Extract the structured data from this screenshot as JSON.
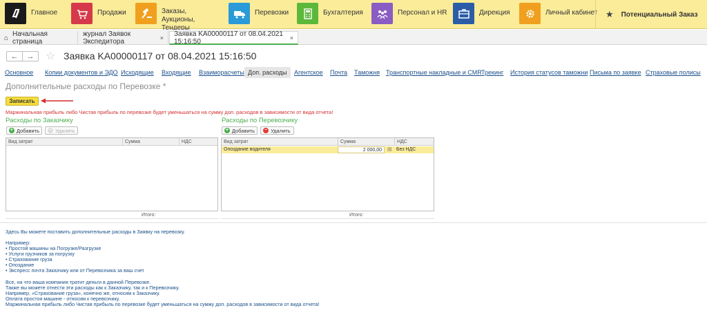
{
  "sections": [
    {
      "label": "Главное",
      "icon": "logo-icon",
      "color": "#1a1a1a"
    },
    {
      "label": "Продажи",
      "icon": "cart-icon",
      "color": "#d63a4a"
    },
    {
      "label": "Заказы, Аукционы, Тендеры",
      "icon": "gavel-icon",
      "color": "#f0a01e"
    },
    {
      "label": "Перевозки",
      "icon": "truck-icon",
      "color": "#2a9ad8"
    },
    {
      "label": "Бухгалтерия",
      "icon": "calculator-icon",
      "color": "#5cb83a"
    },
    {
      "label": "Персонал и HR",
      "icon": "people-icon",
      "color": "#8a5cc4"
    },
    {
      "label": "Дирекция",
      "icon": "briefcase-icon",
      "color": "#2a5ca8"
    },
    {
      "label": "Личный кабинет",
      "icon": "gear-icon",
      "color": "#f0a01e"
    }
  ],
  "favorite": {
    "label": "Потенциальный Заказ",
    "icon": "star-icon"
  },
  "window_tabs": [
    {
      "label": "Начальная страница",
      "icon": "home-icon"
    },
    {
      "label": "журнал Заявок Экспедитора",
      "close": "×"
    },
    {
      "label": "Заявка KA00000117 от 08.04.2021 15:16:50",
      "close": "×"
    }
  ],
  "nav": {
    "back": "←",
    "forward": "→",
    "favorite_icon": "☆"
  },
  "doc_title": "Заявка KA00000117 от 08.04.2021 15:16:50",
  "subtabs": [
    "Основное",
    "Копии документов и ЭДО",
    "Исходящие",
    "Входящие",
    "Взаиморасчеты",
    "Доп. расходы",
    "Агентское",
    "Почта",
    "Таможня",
    "Транспортные накладные и CMR",
    "Трекинг",
    "История статусов таможни",
    "Письма по заявке",
    "Страховые полисы"
  ],
  "active_subtab": "Доп. расходы",
  "form_title": "Дополнительные расходы по Перевозке *",
  "save_button": "Записать",
  "warning": "Маржинальная прибыль либо Чистая прибыль по перевозке будет уменьшаться на сумму доп. расходов в зависимости от вида отчета!",
  "customer_panel": {
    "title": "Расходы по Заказчику",
    "add": "Добавить",
    "remove": "Удалить",
    "columns": [
      "Вид затрат",
      "Сумма",
      "НДС"
    ],
    "rows": [],
    "total_label": "Итого:"
  },
  "carrier_panel": {
    "title": "Расходы по Перевозчику",
    "add": "Добавить",
    "remove": "Удалить",
    "columns": [
      "Вид затрат",
      "Сумма",
      "НДС"
    ],
    "rows": [
      {
        "type": "Опоздание водителя",
        "sum": "2 000,00",
        "vat": "Без НДС"
      }
    ],
    "total_label": "Итого:"
  },
  "help": {
    "intro": "Здесь Вы можете поставить дополнительные расходы в Заявку на перевозку.",
    "example_label": "Например:",
    "examples": [
      "• Простой машины на Погрузке/Разгрузке",
      "• Услуги грузчиков за погрузку",
      "• Страхование груза",
      "• Опоздание",
      "• Экспресс почта Заказчику или от Перевозчика за ваш счет"
    ],
    "notes": [
      "Все, на что ваша компания тратит деньги в данной Перевозке.",
      "Также вы можете отнести эти расходы как к Заказчику, так и к Перевозчику.",
      "Например, «Страхование груза», конечно же, относим к Заказчику.",
      "Оплата простоя машине - относим к перевозчику.",
      "Маржинальная прибыль либо Чистая прибыль по перевозке будет уменьшаться на сумму доп. расходов в зависимости от вида отчета!"
    ]
  },
  "colors": {
    "accent": "#4caf50",
    "warning": "#d32f2f",
    "link": "#1a4f8a",
    "topbar": "#fbec9a"
  }
}
